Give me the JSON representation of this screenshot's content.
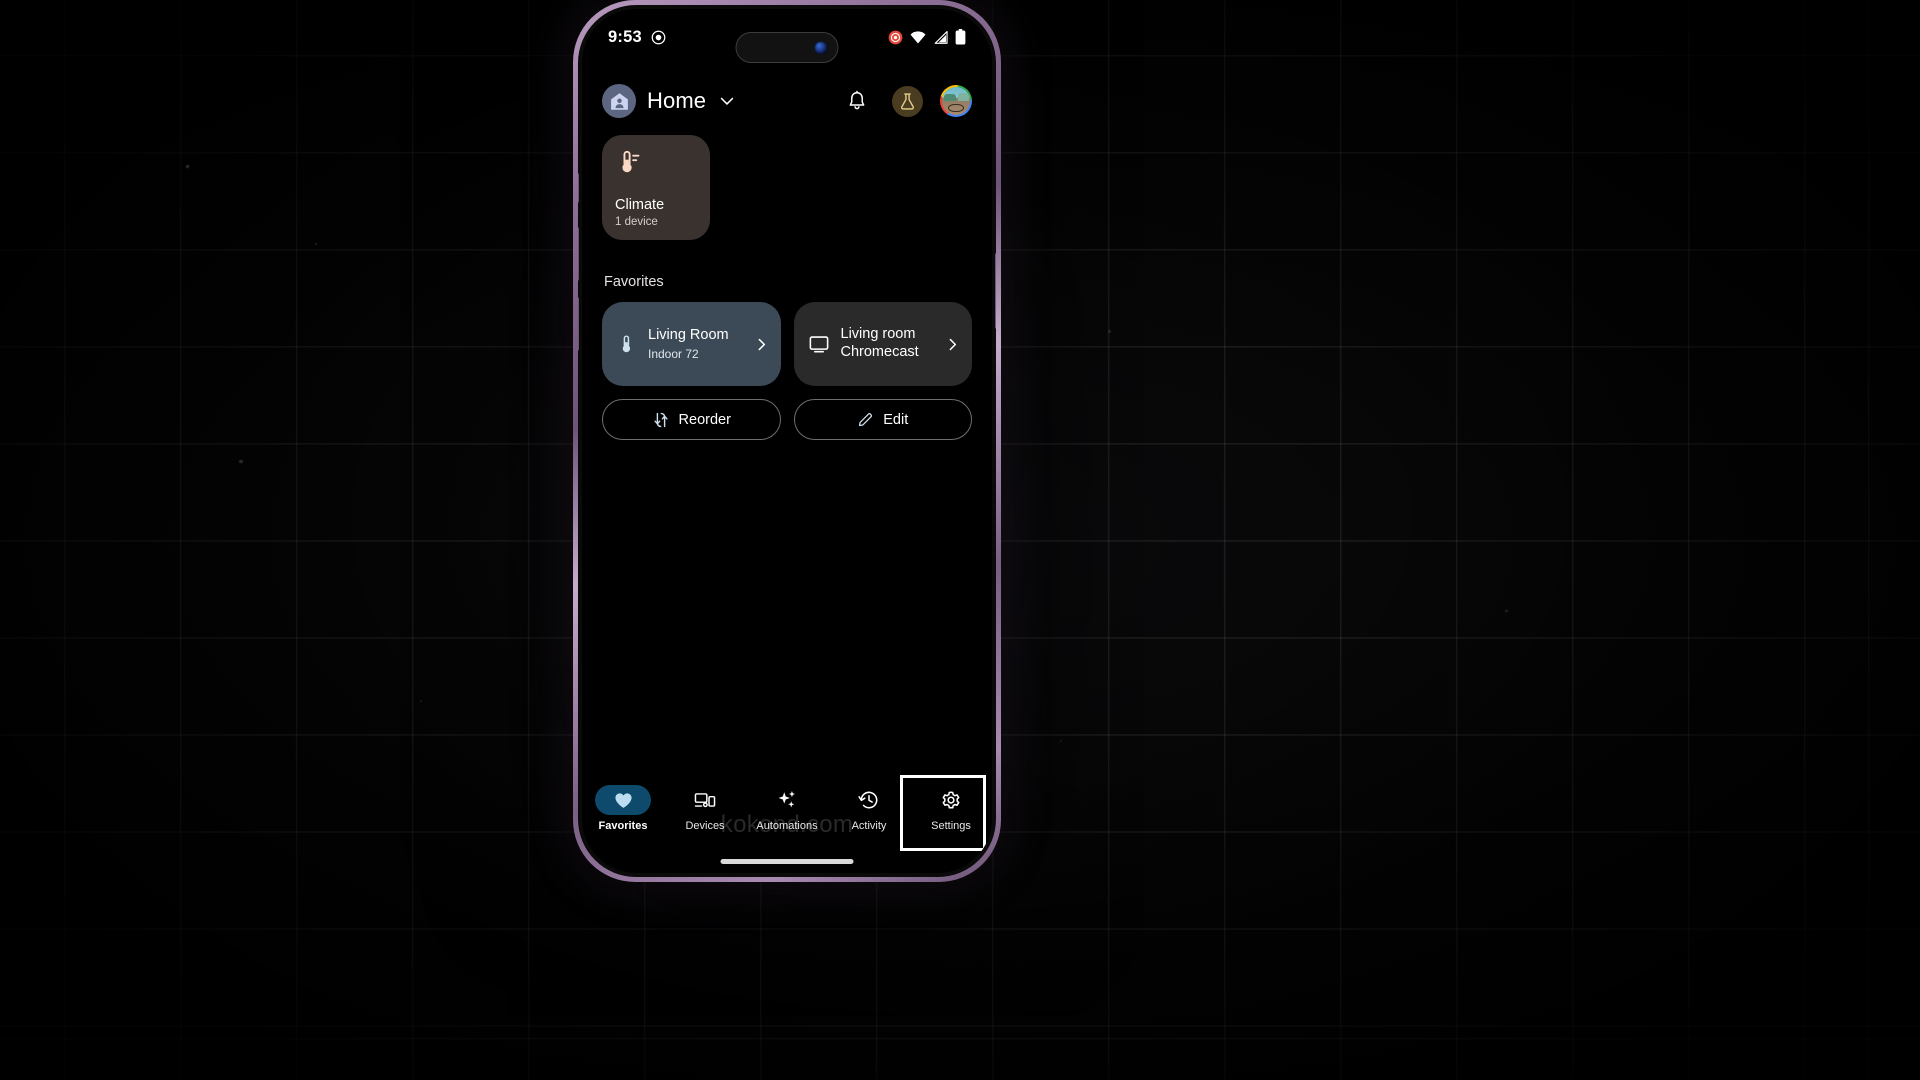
{
  "status_bar": {
    "clock": "9:53",
    "icons": [
      "record-indicator-icon",
      "wifi-icon",
      "cellular-signal-icon",
      "battery-icon"
    ]
  },
  "app_header": {
    "home_icon": "home-avatar-icon",
    "title": "Home",
    "dropdown_icon": "chevron-down-icon",
    "actions": [
      {
        "name": "notifications",
        "icon": "bell-icon"
      },
      {
        "name": "experiments",
        "icon": "flask-icon"
      },
      {
        "name": "account",
        "icon": "profile-avatar"
      }
    ]
  },
  "climate_card": {
    "icon": "thermostat-icon",
    "name": "Climate",
    "subtitle": "1 device"
  },
  "favorites": {
    "section_label": "Favorites",
    "items": [
      {
        "icon": "thermometer-icon",
        "title": "Living Room",
        "subtitle": "Indoor 72",
        "chevron": "chevron-right-icon"
      },
      {
        "icon": "chromecast-icon",
        "title": "Living room",
        "title2": "Chromecast",
        "subtitle": "",
        "chevron": "chevron-right-icon"
      }
    ]
  },
  "actions": {
    "reorder": {
      "label": "Reorder",
      "icon": "reorder-arrows-icon"
    },
    "edit": {
      "label": "Edit",
      "icon": "pencil-icon"
    }
  },
  "bottom_nav": {
    "items": [
      {
        "label": "Favorites",
        "icon": "heart-icon",
        "active": true
      },
      {
        "label": "Devices",
        "icon": "devices-icon",
        "active": false
      },
      {
        "label": "Automations",
        "icon": "sparkles-icon",
        "active": false
      },
      {
        "label": "Activity",
        "icon": "history-icon",
        "active": false
      },
      {
        "label": "Settings",
        "icon": "gear-icon",
        "active": false
      }
    ],
    "highlighted": "Settings"
  },
  "watermark": "kokond.com",
  "colors": {
    "accent_blue": "#0d4a6b",
    "favorite_card": "#3c4a57",
    "chromecast_card": "#2a2a2a",
    "climate_card": "#3a322e",
    "highlight_outline": "#ffffff",
    "phone_frame": "#a98bb2"
  }
}
